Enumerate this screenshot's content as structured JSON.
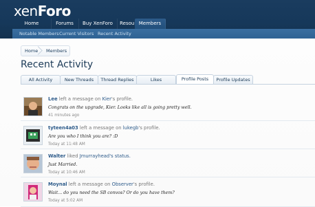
{
  "brand": {
    "logo_prefix": "xen",
    "logo_suffix": "Foro"
  },
  "nav": {
    "tabs": [
      {
        "label": "Home"
      },
      {
        "label": "Forums"
      },
      {
        "label": "Buy XenForo"
      },
      {
        "label": "Resources"
      },
      {
        "label": "Members",
        "active": true
      }
    ],
    "sub_items": [
      {
        "label": "Notable Members"
      },
      {
        "label": "Current Visitors"
      },
      {
        "label": "Recent Activity"
      }
    ]
  },
  "breadcrumb": {
    "items": [
      {
        "label": "Home"
      },
      {
        "label": "Members"
      }
    ]
  },
  "page": {
    "title": "Recent Activity"
  },
  "tabs": [
    {
      "label": "All Activity"
    },
    {
      "label": "New Threads"
    },
    {
      "label": "Thread Replies"
    },
    {
      "label": "Likes"
    },
    {
      "label": "Profile Posts",
      "active": true
    },
    {
      "label": "Profile Updates"
    }
  ],
  "activities": [
    {
      "user": "Lee",
      "action": " left a message on ",
      "target": "Kier",
      "suffix": "'s profile.",
      "message": "Congrats on the upgrade, Kier. Looks like all is going pretty well.",
      "time": "41 minutes ago",
      "avatar": "photo-avatar"
    },
    {
      "user": "tyteen4a03",
      "action": " left a message on ",
      "target": "lukegb",
      "suffix": "'s profile.",
      "message": "Are you who I think you are? :D",
      "time": "Today at 11:48 AM",
      "avatar": "cartoon-avatar"
    },
    {
      "user": "Walter",
      "action": " liked ",
      "target": "Jmurrayhead's status.",
      "suffix": "",
      "message": "Just Married.",
      "time": "Today at 10:46 AM",
      "avatar": "face-avatar"
    },
    {
      "user": "Moynal",
      "action": " left a message on ",
      "target": "Observer",
      "suffix": "'s profile.",
      "message": "Wait... do you need the SB convos? Or do you have them?",
      "time": "Today at 5:02 AM",
      "avatar": "girl-avatar"
    }
  ]
}
